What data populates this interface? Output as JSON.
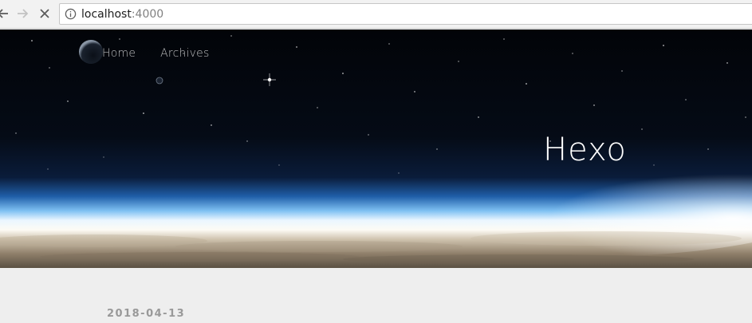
{
  "browser": {
    "url_host": "localhost",
    "url_port": ":4000",
    "back_icon": "arrow-left-icon",
    "forward_icon": "arrow-right-icon",
    "stop_icon": "close-icon",
    "site_info_icon": "info-icon"
  },
  "header": {
    "nav": [
      {
        "label": "Home"
      },
      {
        "label": "Archives"
      }
    ],
    "site_title": "Hexo"
  },
  "main": {
    "post_date": "2018-04-13"
  },
  "colors": {
    "page_background": "#eeeeee",
    "date_text": "#999999",
    "title_text": "#ffffff"
  }
}
